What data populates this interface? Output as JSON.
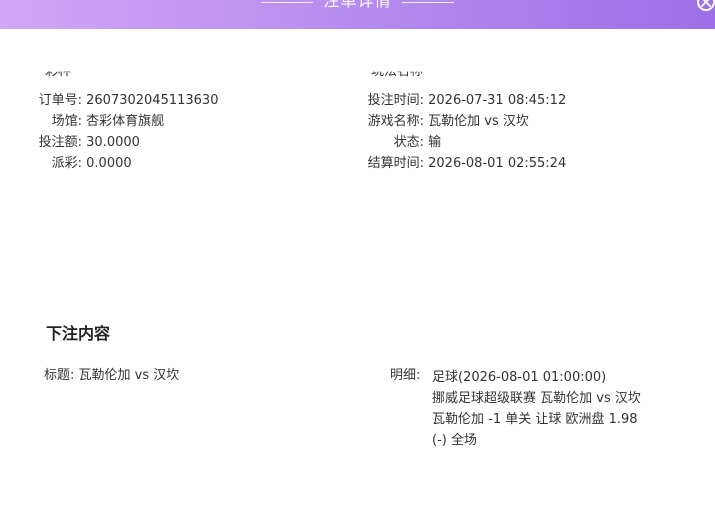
{
  "header": {
    "title": "注单详情"
  },
  "cut_rows": {
    "left_label": "彩种",
    "right_label": "玩法名称"
  },
  "info_left": [
    {
      "label": "订单号:",
      "value": "2607302045113630"
    },
    {
      "label": "场馆:",
      "value": "杏彩体育旗舰"
    },
    {
      "label": "投注额:",
      "value": "30.0000"
    },
    {
      "label": "派彩:",
      "value": "0.0000"
    }
  ],
  "info_right": [
    {
      "label": "投注时间:",
      "value": "2026-07-31 08:45:12"
    },
    {
      "label": "游戏名称:",
      "value": "瓦勒伦加 vs 汉坎"
    },
    {
      "label": "状态:",
      "value": "输"
    },
    {
      "label": "结算时间:",
      "value": "2026-08-01 02:55:24"
    }
  ],
  "bet_section": {
    "title": "下注内容",
    "subject_label": "标题:",
    "subject_value": "瓦勒伦加 vs 汉坎",
    "detail_label": "明细:",
    "detail_lines": [
      "足球(2026-08-01 01:00:00)",
      "挪威足球超级联赛 瓦勒伦加 vs 汉坎",
      "瓦勒伦加 -1 单关 让球 欧洲盘 1.98",
      "(-) 全场"
    ]
  }
}
